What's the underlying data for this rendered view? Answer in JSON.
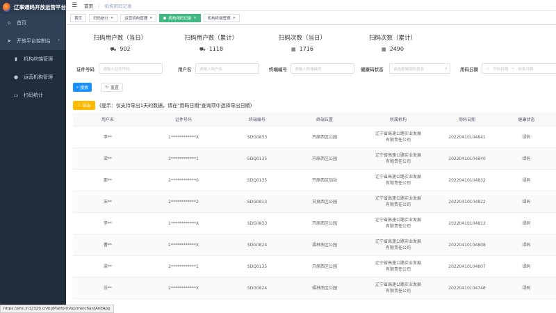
{
  "app": {
    "title": "辽事通码开放运营平台"
  },
  "sidebar": {
    "items": [
      {
        "label": "首页",
        "icon": "home-icon",
        "glyph": "⌂"
      },
      {
        "label": "开放平台控制台",
        "icon": "send-icon",
        "glyph": "➤",
        "caret": "⌃"
      },
      {
        "label": "机构终端管理",
        "icon": "chart-icon",
        "glyph": "▮"
      },
      {
        "label": "运营机构管理",
        "icon": "user-icon",
        "glyph": "●"
      },
      {
        "label": "扫码统计",
        "icon": "monitor-icon",
        "glyph": "▭"
      }
    ]
  },
  "header": {
    "menu_icon": "☰",
    "breadcrumb": [
      "首页",
      "机构用码记录"
    ]
  },
  "tags": [
    {
      "label": "首页",
      "active": false
    },
    {
      "label": "扫码统计",
      "active": false
    },
    {
      "label": "运营机构管理",
      "active": false
    },
    {
      "label": "机构用码记录",
      "active": true
    },
    {
      "label": "机构终端管理",
      "active": false
    }
  ],
  "stats": [
    {
      "title": "扫码用户数（当日）",
      "icon": "car-icon",
      "glyph": "⛟",
      "value": "902"
    },
    {
      "title": "扫码用户数（累计）",
      "icon": "car-icon",
      "glyph": "⛟",
      "value": "1118"
    },
    {
      "title": "扫码次数（当日）",
      "icon": "grid-icon",
      "glyph": "▦",
      "value": "1716"
    },
    {
      "title": "扫码次数（累计）",
      "icon": "grid-icon",
      "glyph": "▦",
      "value": "2490"
    }
  ],
  "filters": {
    "id_label": "证件号码",
    "id_placeholder": "请输入证件号码",
    "name_label": "用户名",
    "name_placeholder": "请输入用户名",
    "terminal_label": "终端编号",
    "terminal_placeholder": "请输入终端编号",
    "health_label": "健康码状态",
    "health_placeholder": "请选择健康码状态",
    "date_label": "用码日期",
    "date_start": "开始日期",
    "date_sep": "-",
    "date_end": "结束日期"
  },
  "buttons": {
    "search": "搜索",
    "reset": "重置",
    "export": "导出"
  },
  "tip": "(提示：仅支持导出1天的数据，请在\"用码日期\"查询项中选择导出日期)",
  "table": {
    "headers": [
      "用户名",
      "证件号码",
      "终端编号",
      "终端位置",
      "所属机构",
      "用码日期",
      "健康状态"
    ],
    "rows": [
      [
        "李**",
        "1************X",
        "SDG0833",
        "开原西区公园",
        "辽宁省高速公路实业发展有限责任公司",
        "20220410104841",
        "绿码"
      ],
      [
        "梁**",
        "2************1",
        "SDQ0135",
        "开原西区公园",
        "辽宁省高速公路实业发展有限责任公司",
        "20220410104840",
        "绿码"
      ],
      [
        "那**",
        "2************0",
        "SDQ0135",
        "开原西区加站",
        "辽宁省高速公路实业发展有限责任公司",
        "20220410104832",
        "绿码"
      ],
      [
        "宋**",
        "2************2",
        "SDG0813",
        "甘泉西区公园",
        "辽宁省高速公路实业发展有限责任公司",
        "20220410104822",
        "绿码"
      ],
      [
        "李**",
        "1************X",
        "SDG0833",
        "开原西区公园",
        "辽宁省高速公路实业发展有限责任公司",
        "20220410104813",
        "绿码"
      ],
      [
        "曹**",
        "2************X",
        "SDG0824",
        "福林南区公园",
        "辽宁省高速公路实业发展有限责任公司",
        "20220410104808",
        "绿码"
      ],
      [
        "梁**",
        "2************1",
        "SDQ0135",
        "开原西区公园",
        "辽宁省高速公路实业发展有限责任公司",
        "20220410104807",
        "绿码"
      ],
      [
        "张**",
        "2************X",
        "SDG0824",
        "福林南区公园",
        "辽宁省高速公路实业发展有限责任公司",
        "20220410104746",
        "绿码"
      ]
    ]
  },
  "statusbar": "https://ehc.ln12320.cn/bizPlatform/op/merchantAndApp"
}
